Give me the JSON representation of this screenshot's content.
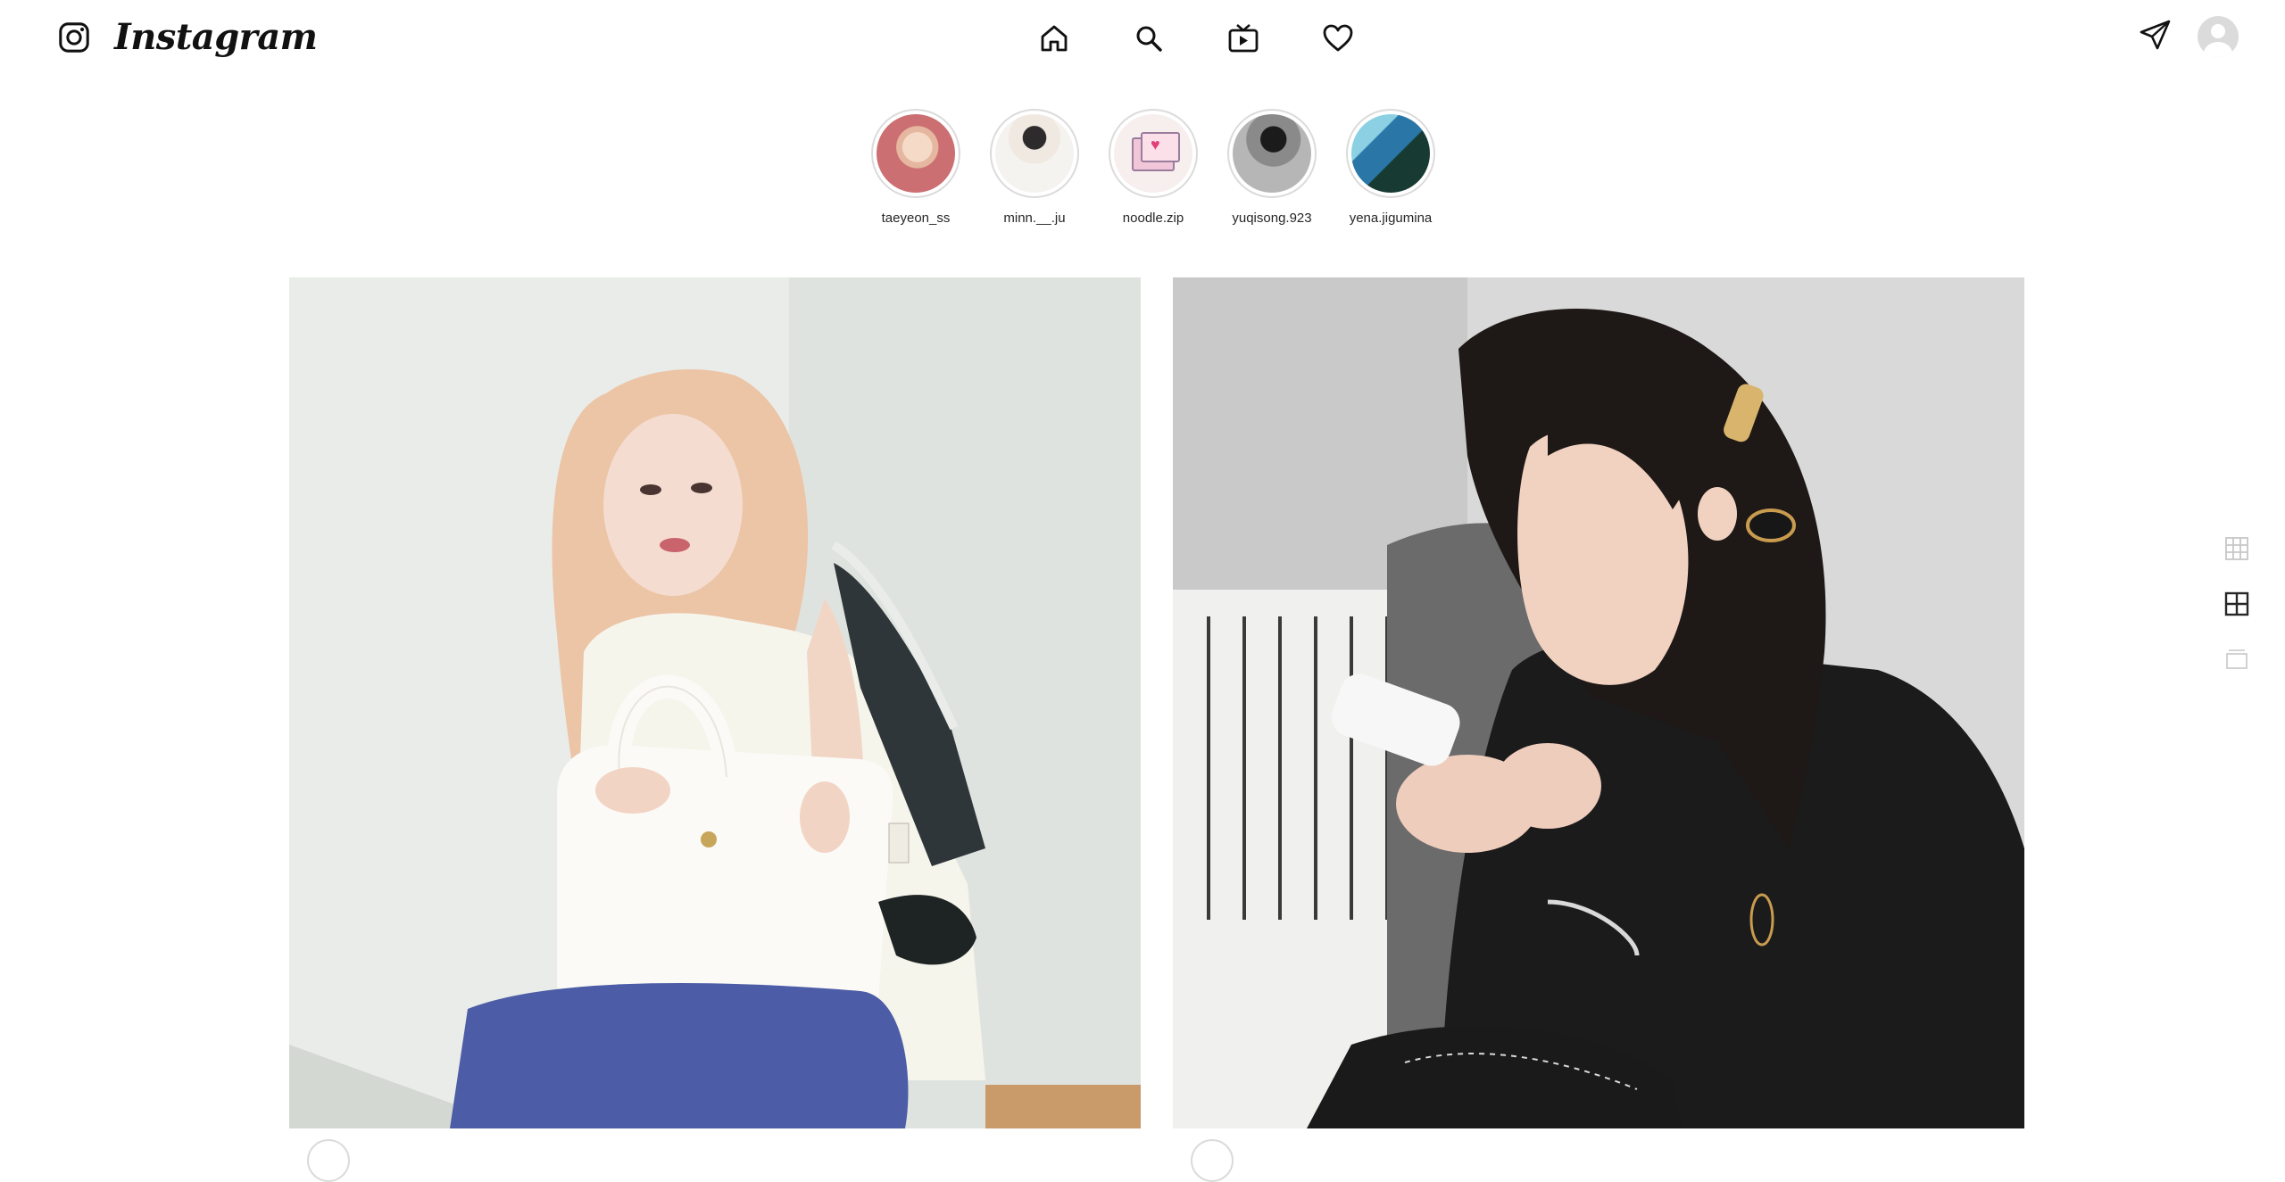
{
  "header": {
    "wordmark": "Instagram",
    "logo_icon": "instagram-glyph-icon",
    "nav": [
      {
        "icon": "home-icon"
      },
      {
        "icon": "search-icon"
      },
      {
        "icon": "igtv-icon"
      },
      {
        "icon": "heart-icon"
      }
    ],
    "direct_icon": "paper-plane-icon",
    "avatar_icon": "default-avatar-icon"
  },
  "stories": [
    {
      "username": "taeyeon_ss"
    },
    {
      "username": "minn.__.ju"
    },
    {
      "username": "noodle.zip"
    },
    {
      "username": "yuqisong.923"
    },
    {
      "username": "yena.jigumina"
    }
  ],
  "layout_switcher": [
    {
      "icon": "grid-3x3-icon",
      "active": false
    },
    {
      "icon": "grid-2x2-icon",
      "active": true
    },
    {
      "icon": "single-column-icon",
      "active": false
    }
  ],
  "colors": {
    "text": "#262626",
    "border": "#dbdbdb",
    "inactive_icon": "#c7c7c7"
  }
}
